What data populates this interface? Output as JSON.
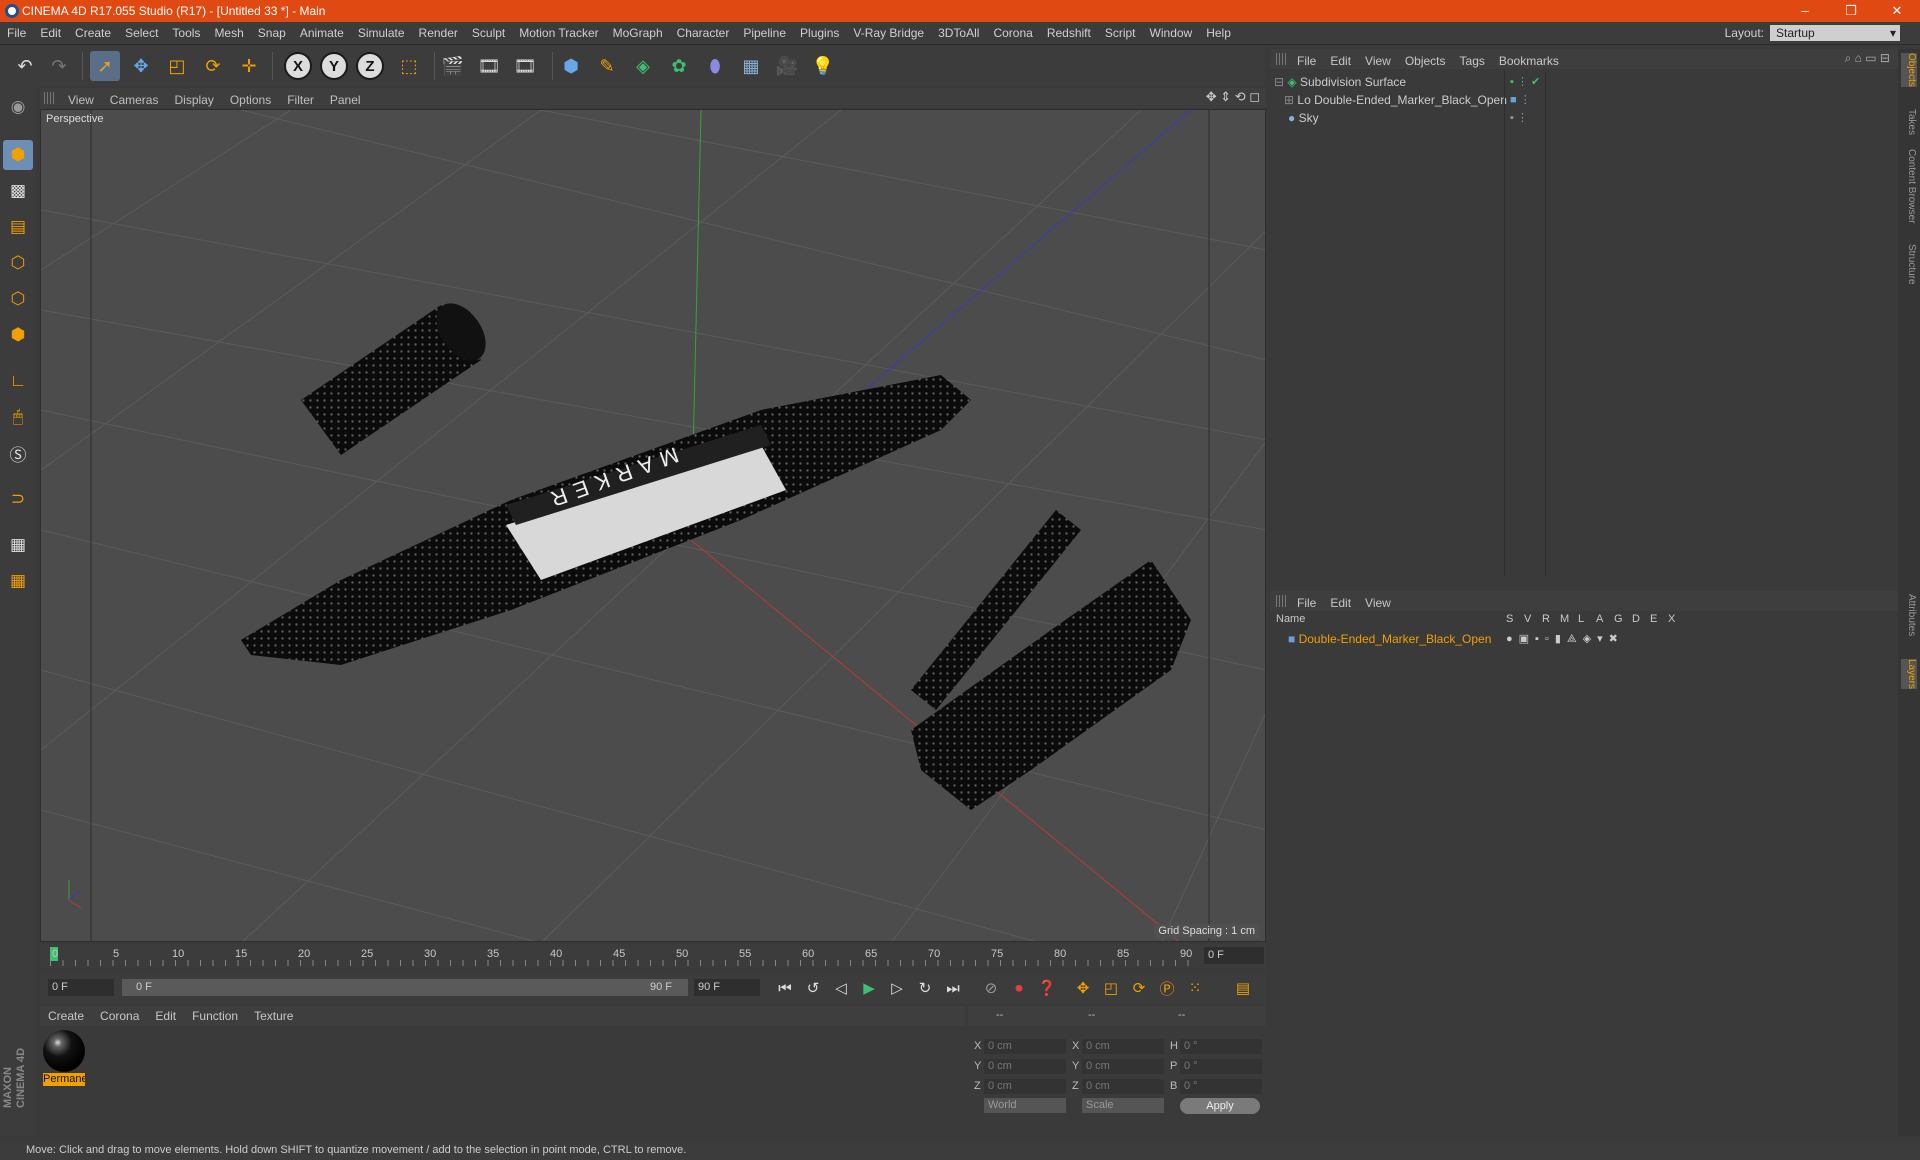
{
  "window": {
    "title": "CINEMA 4D R17.055 Studio (R17) - [Untitled 33 *] - Main",
    "controls": [
      "–",
      "❒",
      "✕"
    ]
  },
  "menu": [
    "File",
    "Edit",
    "Create",
    "Select",
    "Tools",
    "Mesh",
    "Snap",
    "Animate",
    "Simulate",
    "Render",
    "Sculpt",
    "Motion Tracker",
    "MoGraph",
    "Character",
    "Pipeline",
    "Plugins",
    "V-Ray Bridge",
    "3DToAll",
    "Corona",
    "Redshift",
    "Script",
    "Window",
    "Help"
  ],
  "layout": {
    "label": "Layout:",
    "value": "Startup"
  },
  "toolbar_icons": [
    "undo-icon",
    "redo-icon",
    "select-icon",
    "move-icon",
    "scale-icon",
    "rotate-icon",
    "add-icon",
    "x-axis-icon",
    "y-axis-icon",
    "z-axis-icon",
    "coordinate-system-icon",
    "render-view-icon",
    "render-picture-viewer-icon",
    "render-settings-icon",
    "cube-icon",
    "pen-icon",
    "subdivision-icon",
    "mograph-icon",
    "deformer-icon",
    "floor-icon",
    "camera-icon",
    "light-icon"
  ],
  "toolbar_axes": [
    "X",
    "Y",
    "Z"
  ],
  "viewport": {
    "menu": [
      "View",
      "Cameras",
      "Display",
      "Options",
      "Filter",
      "Panel"
    ],
    "label": "Perspective",
    "grid_spacing": "Grid Spacing : 1 cm",
    "model_text": "MARKER"
  },
  "timeline": {
    "ticks": [
      "0",
      "5",
      "10",
      "15",
      "20",
      "25",
      "30",
      "35",
      "40",
      "45",
      "50",
      "55",
      "60",
      "65",
      "70",
      "75",
      "80",
      "85",
      "90"
    ],
    "current": "0 F"
  },
  "transport": {
    "start": "0 F",
    "range_start": "0 F",
    "range_end": "90 F",
    "end": "90 F"
  },
  "material_panel": {
    "menu": [
      "Create",
      "Corona",
      "Edit",
      "Function",
      "Texture"
    ],
    "material_name": "Permanent"
  },
  "attributes": {
    "headers": [
      "--",
      "--",
      "--"
    ],
    "rows": [
      {
        "a": "X",
        "av": "0 cm",
        "b": "X",
        "bv": "0 cm",
        "c": "H",
        "cv": "0 °"
      },
      {
        "a": "Y",
        "av": "0 cm",
        "b": "Y",
        "bv": "0 cm",
        "c": "P",
        "cv": "0 °"
      },
      {
        "a": "Z",
        "av": "0 cm",
        "b": "Z",
        "bv": "0 cm",
        "c": "B",
        "cv": "0 °"
      }
    ],
    "coord_mode": "World",
    "size_mode": "Scale",
    "apply": "Apply"
  },
  "objects_panel": {
    "menu": [
      "File",
      "Edit",
      "View",
      "Objects",
      "Tags",
      "Bookmarks"
    ],
    "items": [
      "Subdivision Surface",
      "Double-Ended_Marker_Black_Open",
      "Sky"
    ]
  },
  "layers_panel": {
    "menu": [
      "File",
      "Edit",
      "View"
    ],
    "columns": [
      "Name",
      "S",
      "V",
      "R",
      "M",
      "L",
      "A",
      "G",
      "D",
      "E",
      "X"
    ],
    "layer": "Double-Ended_Marker_Black_Open"
  },
  "side_tabs": [
    "Objects",
    "Takes",
    "Content Browser",
    "Structure",
    "Attributes",
    "Layers"
  ],
  "status": "Move: Click and drag to move elements. Hold down SHIFT to quantize movement / add to the selection in point mode, CTRL to remove.",
  "brand": "MAXON CINEMA 4D",
  "colors": {
    "title_bar": "#e04a12",
    "accent": "#f0a000",
    "selection": "#6e8fb5",
    "layer_text": "#f0a000"
  }
}
